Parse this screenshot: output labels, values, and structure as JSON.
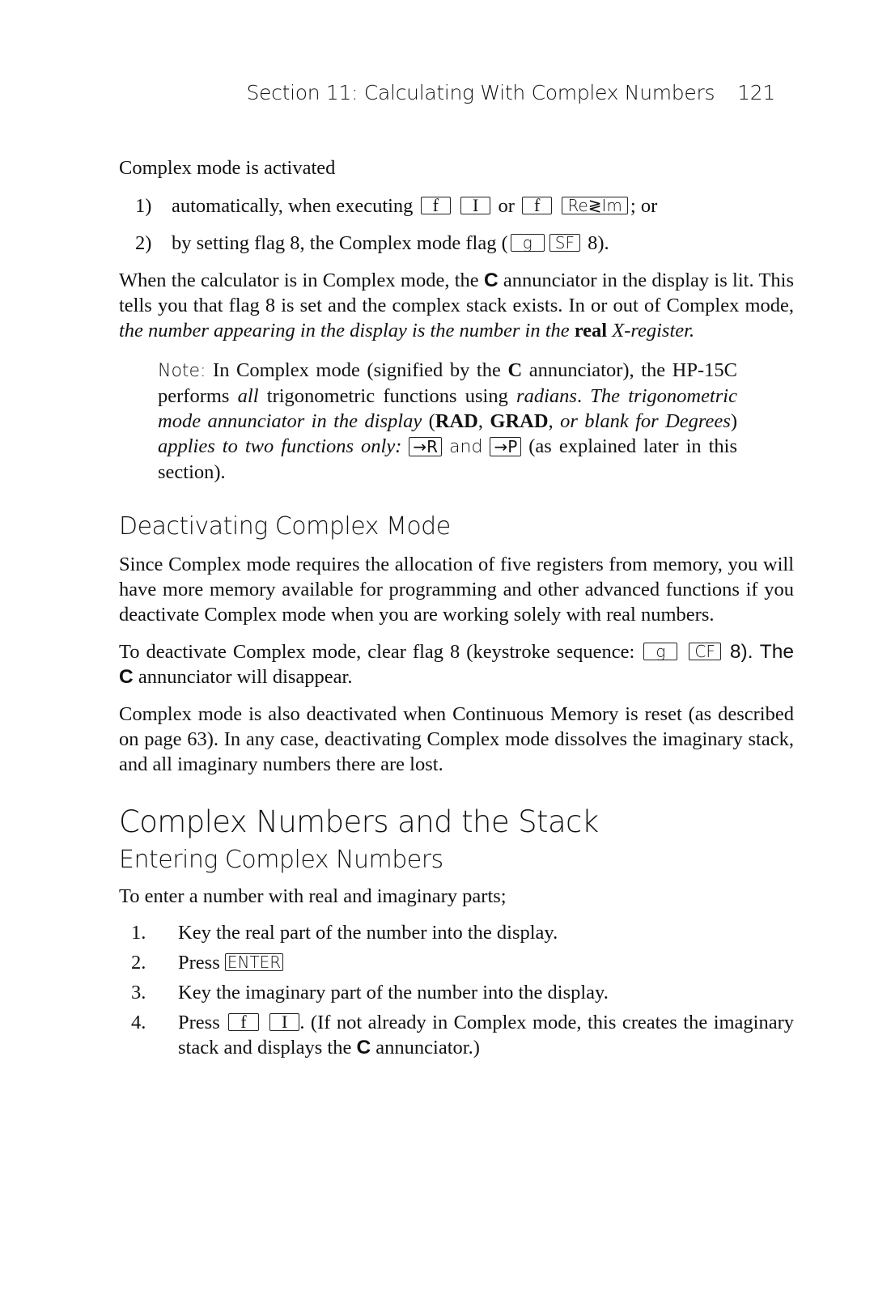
{
  "header": {
    "section_title": "Section 11: Calculating With Complex Numbers",
    "page_number": "121"
  },
  "activation": {
    "intro": "Complex mode is activated",
    "items": [
      {
        "number": "1)",
        "text_before": "automatically, when executing",
        "keys_a": [
          "f",
          "I"
        ],
        "or": "or",
        "keys_b": [
          "f",
          "Re≷Im"
        ],
        "text_after": "; or"
      },
      {
        "number": "2)",
        "text_before": "by setting flag 8, the Complex mode flag (",
        "keys": [
          "g",
          "SF"
        ],
        "text_after": " 8)."
      }
    ]
  },
  "complex_mode_para": {
    "part1": "When the calculator is in Complex mode, the ",
    "annunciator": "C",
    "part2": " annunciator in the display is lit. This tells you that flag 8 is set and the complex stack exists. In or out of Complex mode, ",
    "italic": "the number appearing in the display is the number in the",
    "bold": "real",
    "italic2": "X-register."
  },
  "note": {
    "label": "Note:",
    "t1": " In Complex mode (signified by the ",
    "annunciator": "C",
    "t2": " annunciator), the HP-15C performs ",
    "all": "all",
    "t3": " trigonometric functions using ",
    "radians": "radians",
    "t4": ". ",
    "it1": "The trigonometric mode annunciator in the display",
    "t5": " (",
    "rad": "RAD",
    "comma": ", ",
    "grad": "GRAD",
    "it2": ", or blank for Degrees",
    "t6": ") ",
    "it3": "applies to two functions only:",
    "key_r": "→R",
    "and": "and",
    "key_p": "→P",
    "t7": "(as explained later in this section)."
  },
  "deactivating": {
    "heading": "Deactivating Complex Mode",
    "para1": "Since Complex mode requires the allocation of five registers from memory, you will have more memory available for programming and other advanced functions if you deactivate Complex mode when you are working solely with real numbers.",
    "para2_before": "To deactivate Complex mode, clear flag 8 (keystroke sequence:",
    "para2_keys": [
      "g",
      "CF"
    ],
    "para2_8": "8). The ",
    "para2_annunciator": "C",
    "para2_after": " annunciator will disappear.",
    "para3": "Complex mode is also deactivated when Continuous Memory is reset (as described on page 63). In any case, deactivating Complex mode dissolves the imaginary stack, and all imaginary numbers there are lost."
  },
  "stack_section": {
    "heading": "Complex Numbers and the Stack",
    "subheading": "Entering Complex Numbers",
    "intro": "To enter a number with real and imaginary parts;",
    "steps": [
      {
        "number": "1.",
        "text": "Key the real part of the number into the display."
      },
      {
        "number": "2.",
        "text": "Press",
        "key": "ENTER"
      },
      {
        "number": "3.",
        "text": "Key the imaginary part of the number into the display."
      },
      {
        "number": "4.",
        "text": "Press",
        "keys": [
          "f",
          "I"
        ],
        "after": ". (If not already in Complex mode, this creates the imaginary stack and displays the ",
        "annunciator": "C",
        "after2": " annunciator.)"
      }
    ]
  }
}
